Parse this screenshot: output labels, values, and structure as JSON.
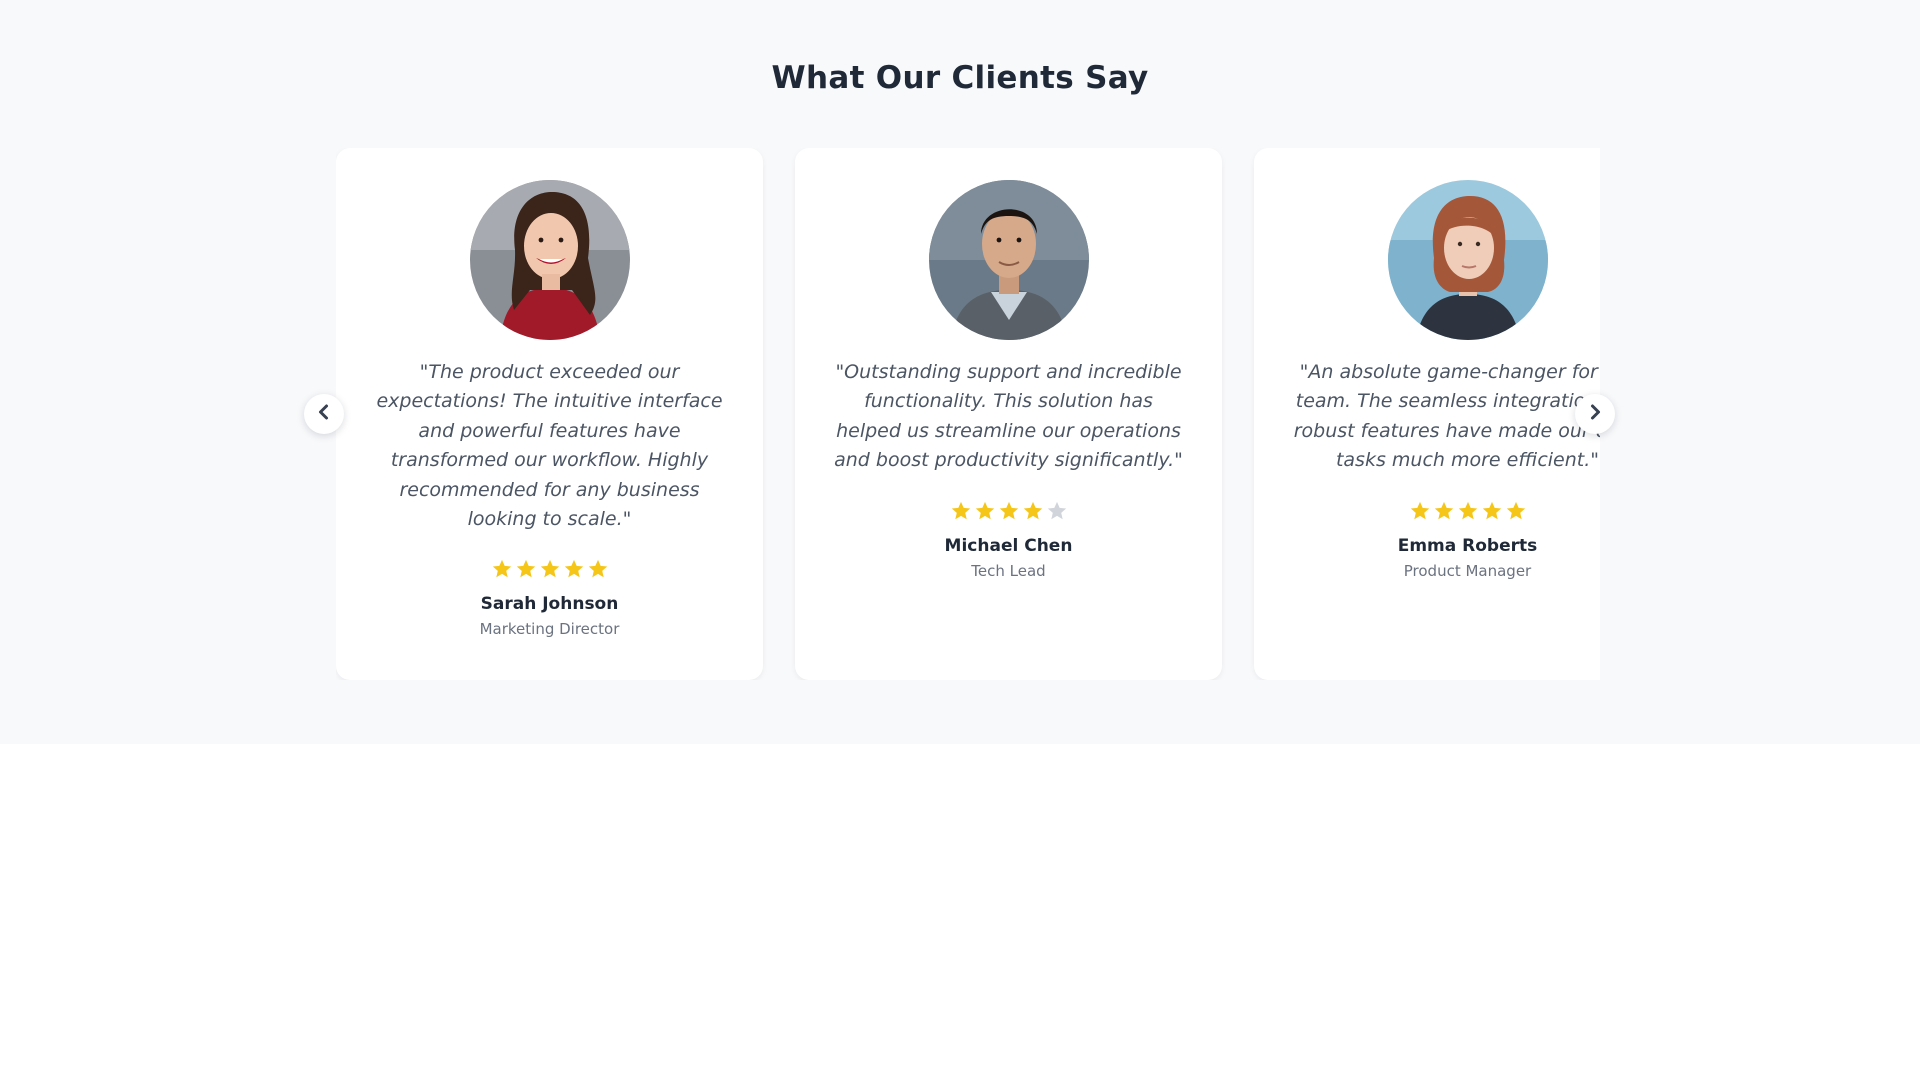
{
  "section": {
    "title": "What Our Clients Say"
  },
  "colors": {
    "star_filled": "#f5c518",
    "star_empty": "#d1d5db"
  },
  "navigation": {
    "prev_icon": "chevron-left-icon",
    "next_icon": "chevron-right-icon"
  },
  "testimonials": [
    {
      "quote": "\"The product exceeded our expectations! The intuitive interface and powerful features have transformed our workflow. Highly recommended for any business looking to scale.\"",
      "rating": 5,
      "max_rating": 5,
      "name": "Sarah Johnson",
      "role": "Marketing Director",
      "avatar": "avatar-photo"
    },
    {
      "quote": "\"Outstanding support and incredible functionality. This solution has helped us streamline our operations and boost productivity significantly.\"",
      "rating": 4,
      "max_rating": 5,
      "name": "Michael Chen",
      "role": "Tech Lead",
      "avatar": "avatar-photo"
    },
    {
      "quote": "\"An absolute game-changer for our team. The seamless integration and robust features have made our daily tasks much more efficient.\"",
      "rating": 5,
      "max_rating": 5,
      "name": "Emma Roberts",
      "role": "Product Manager",
      "avatar": "avatar-photo"
    }
  ]
}
